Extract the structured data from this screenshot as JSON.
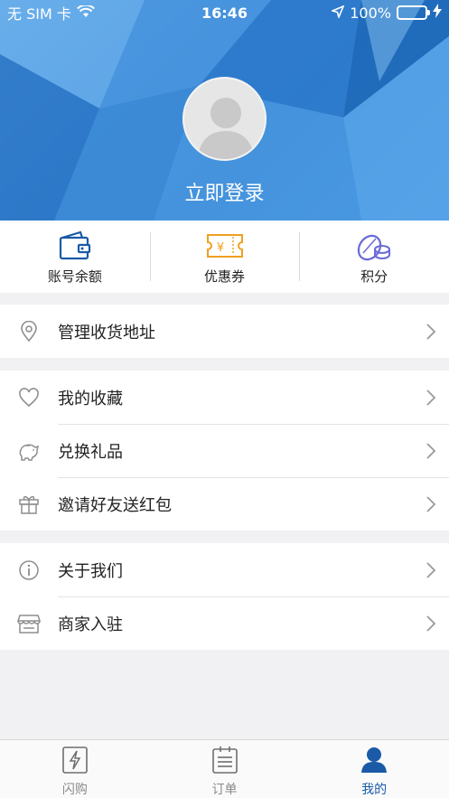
{
  "status_bar": {
    "carrier": "无 SIM 卡",
    "time": "16:46",
    "battery": "100%",
    "battery_level": 1.0
  },
  "profile": {
    "login_text": "立即登录",
    "avatar_icon": "user-avatar-placeholder"
  },
  "quick_actions": [
    {
      "label": "账号余额",
      "icon": "wallet-icon"
    },
    {
      "label": "优惠券",
      "icon": "coupon-icon"
    },
    {
      "label": "积分",
      "icon": "coins-icon"
    }
  ],
  "menu": {
    "address": {
      "label": "管理收货地址",
      "icon": "location-pin-icon"
    },
    "favorites": {
      "label": "我的收藏",
      "icon": "heart-icon"
    },
    "gifts": {
      "label": "兑换礼品",
      "icon": "piggy-bank-icon"
    },
    "invite": {
      "label": "邀请好友送红包",
      "icon": "gift-icon"
    },
    "about": {
      "label": "关于我们",
      "icon": "info-icon"
    },
    "merchant": {
      "label": "商家入驻",
      "icon": "store-icon"
    }
  },
  "tabbar": [
    {
      "label": "闪购",
      "icon": "flash-icon",
      "active": false
    },
    {
      "label": "订单",
      "icon": "order-list-icon",
      "active": false
    },
    {
      "label": "我的",
      "icon": "user-icon",
      "active": true
    }
  ],
  "colors": {
    "accent": "#1a5aa6",
    "header_blue": "#2f7fcf",
    "coupon_orange": "#f0a020",
    "points_purple": "#6a6ad8",
    "wallet_blue": "#1a5aa6"
  }
}
